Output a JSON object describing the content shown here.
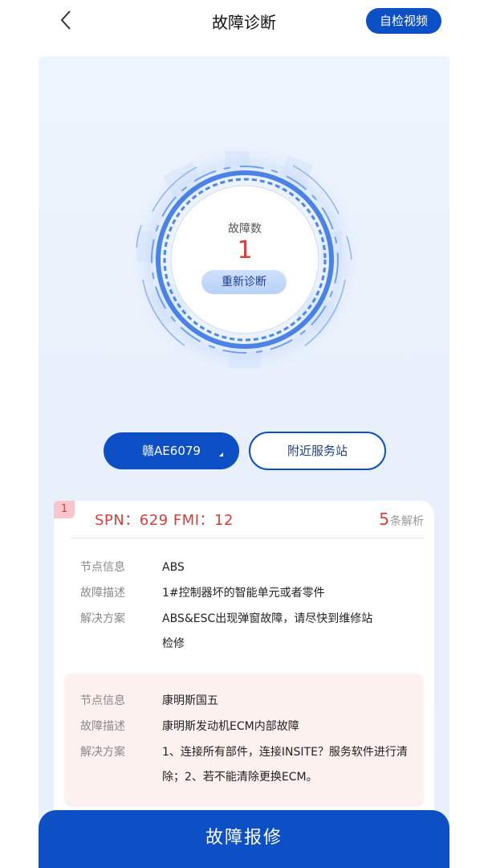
{
  "header": {
    "title": "故障诊断",
    "video_button": "自检视频"
  },
  "icons": {
    "back": "chevron-left-icon",
    "dropdown": "caret-icon"
  },
  "gauge": {
    "label": "故障数",
    "count": "1",
    "rediagnose_button": "重新诊断"
  },
  "vehicle": {
    "plate": "赣AE6079",
    "nearby_station_button": "附近服务站"
  },
  "fault": {
    "index": "1",
    "code": "SPN：629 FMI：12",
    "analysis_count": "5",
    "analysis_label": "条解析",
    "entries": [
      {
        "node_key": "节点信息",
        "node": "ABS",
        "desc_key": "故障描述",
        "desc": "1#控制器坏的智能单元或者零件",
        "solution_key": "解决方案",
        "solution": "ABS&ESC出现弹窗故障，请尽快到维修站检修"
      },
      {
        "node_key": "节点信息",
        "node": "康明斯国五",
        "desc_key": "故障描述",
        "desc": "康明斯发动机ECM内部故障",
        "solution_key": "解决方案",
        "solution": "1、连接所有部件，连接INSITE？服务软件进行清除；2、若不能清除更换ECM。"
      }
    ]
  },
  "footer": {
    "report_button": "故障报修"
  },
  "colors": {
    "primary": "#0d4fc4",
    "fault_red": "#d93e3e",
    "panel_bg": "#eef4fd",
    "alt_entry_bg": "#fdf1ef"
  }
}
